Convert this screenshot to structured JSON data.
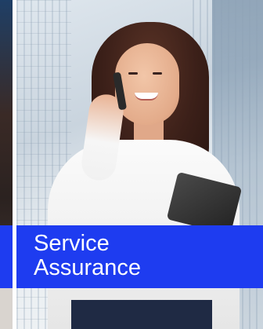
{
  "card": {
    "title_line1": "Service",
    "title_line2": "Assurance"
  },
  "colors": {
    "accent_band": "#1e3cf0",
    "title_text": "#ffffff"
  }
}
